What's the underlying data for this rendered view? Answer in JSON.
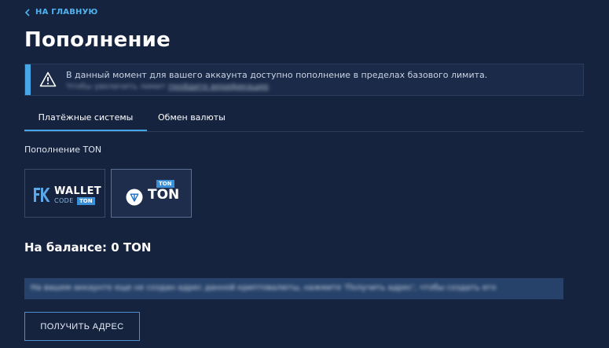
{
  "nav": {
    "back_label": "НА ГЛАВНУЮ"
  },
  "page": {
    "title": "Пополнение"
  },
  "alert": {
    "text": "В данный момент для вашего аккаунта доступно пополнение в пределах базового лимита.",
    "sub_text": "Чтобы увеличить лимит",
    "sub_link": "пройдите верификацию"
  },
  "tabs": [
    {
      "label": "Платёжные системы",
      "active": true
    },
    {
      "label": "Обмен валюты",
      "active": false
    }
  ],
  "section": {
    "label": "Пополнение TON"
  },
  "methods": {
    "wallet": {
      "title": "WALLET",
      "code": "CODE",
      "tag": "TON"
    },
    "ton": {
      "word": "TON",
      "tag": "TON"
    }
  },
  "balance": {
    "text": "На балансе: 0 TON"
  },
  "notice": {
    "text": "На вашем аккаунте еще не создан адрес данной криптовалюты, нажмите 'Получить адрес', чтобы создать его"
  },
  "actions": {
    "get_address_label": "ПОЛУЧИТЬ АДРЕС"
  },
  "colors": {
    "background": "#16233f",
    "accent": "#47a6e6",
    "link": "#4fb3f0",
    "notice_bg": "#26426a"
  }
}
